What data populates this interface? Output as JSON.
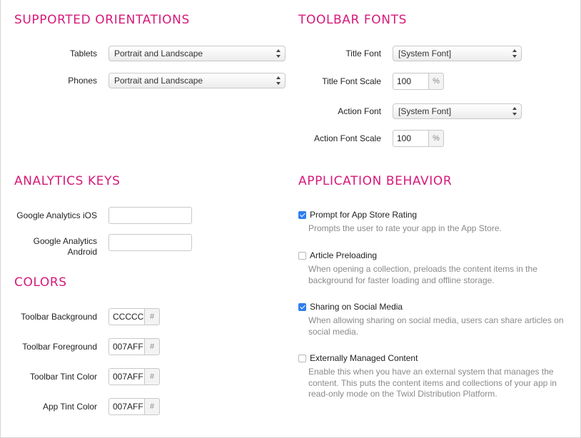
{
  "orientations": {
    "title": "SUPPORTED ORIENTATIONS",
    "tablets_label": "Tablets",
    "tablets_value": "Portrait and Landscape",
    "phones_label": "Phones",
    "phones_value": "Portrait and Landscape"
  },
  "toolbar_fonts": {
    "title": "TOOLBAR FONTS",
    "title_font_label": "Title Font",
    "title_font_value": "[System Font]",
    "title_scale_label": "Title Font Scale",
    "title_scale_value": "100",
    "action_font_label": "Action Font",
    "action_font_value": "[System Font]",
    "action_scale_label": "Action Font Scale",
    "action_scale_value": "100",
    "percent": "%"
  },
  "analytics": {
    "title": "ANALYTICS KEYS",
    "ios_label": "Google Analytics iOS",
    "android_label_line1": "Google Analytics",
    "android_label_line2": "Android",
    "ios_value": "",
    "android_value": ""
  },
  "colors": {
    "title": "COLORS",
    "hash": "#",
    "items": [
      {
        "label": "Toolbar Background",
        "value": "CCCCCC"
      },
      {
        "label": "Toolbar Foreground",
        "value": "007AFF"
      },
      {
        "label": "Toolbar Tint Color",
        "value": "007AFF"
      },
      {
        "label": "App Tint Color",
        "value": "007AFF"
      }
    ]
  },
  "behavior": {
    "title": "APPLICATION BEHAVIOR",
    "items": [
      {
        "label": "Prompt for App Store Rating",
        "checked": true,
        "help": "Prompts the user to rate your app in the App Store."
      },
      {
        "label": "Article Preloading",
        "checked": false,
        "help": "When opening a collection, preloads the content items in the background for faster loading and offline storage."
      },
      {
        "label": "Sharing on Social Media",
        "checked": true,
        "help": "When allowing sharing on social media, users can share articles on social media."
      },
      {
        "label": "Externally Managed Content",
        "checked": false,
        "help": "Enable this when you have an external system that manages the content. This puts the content items and collections of your app in read-only mode on the Twixl Distribution Platform."
      }
    ]
  },
  "accent_color": "#d6197a",
  "checkbox_color": "#2f7ef0"
}
